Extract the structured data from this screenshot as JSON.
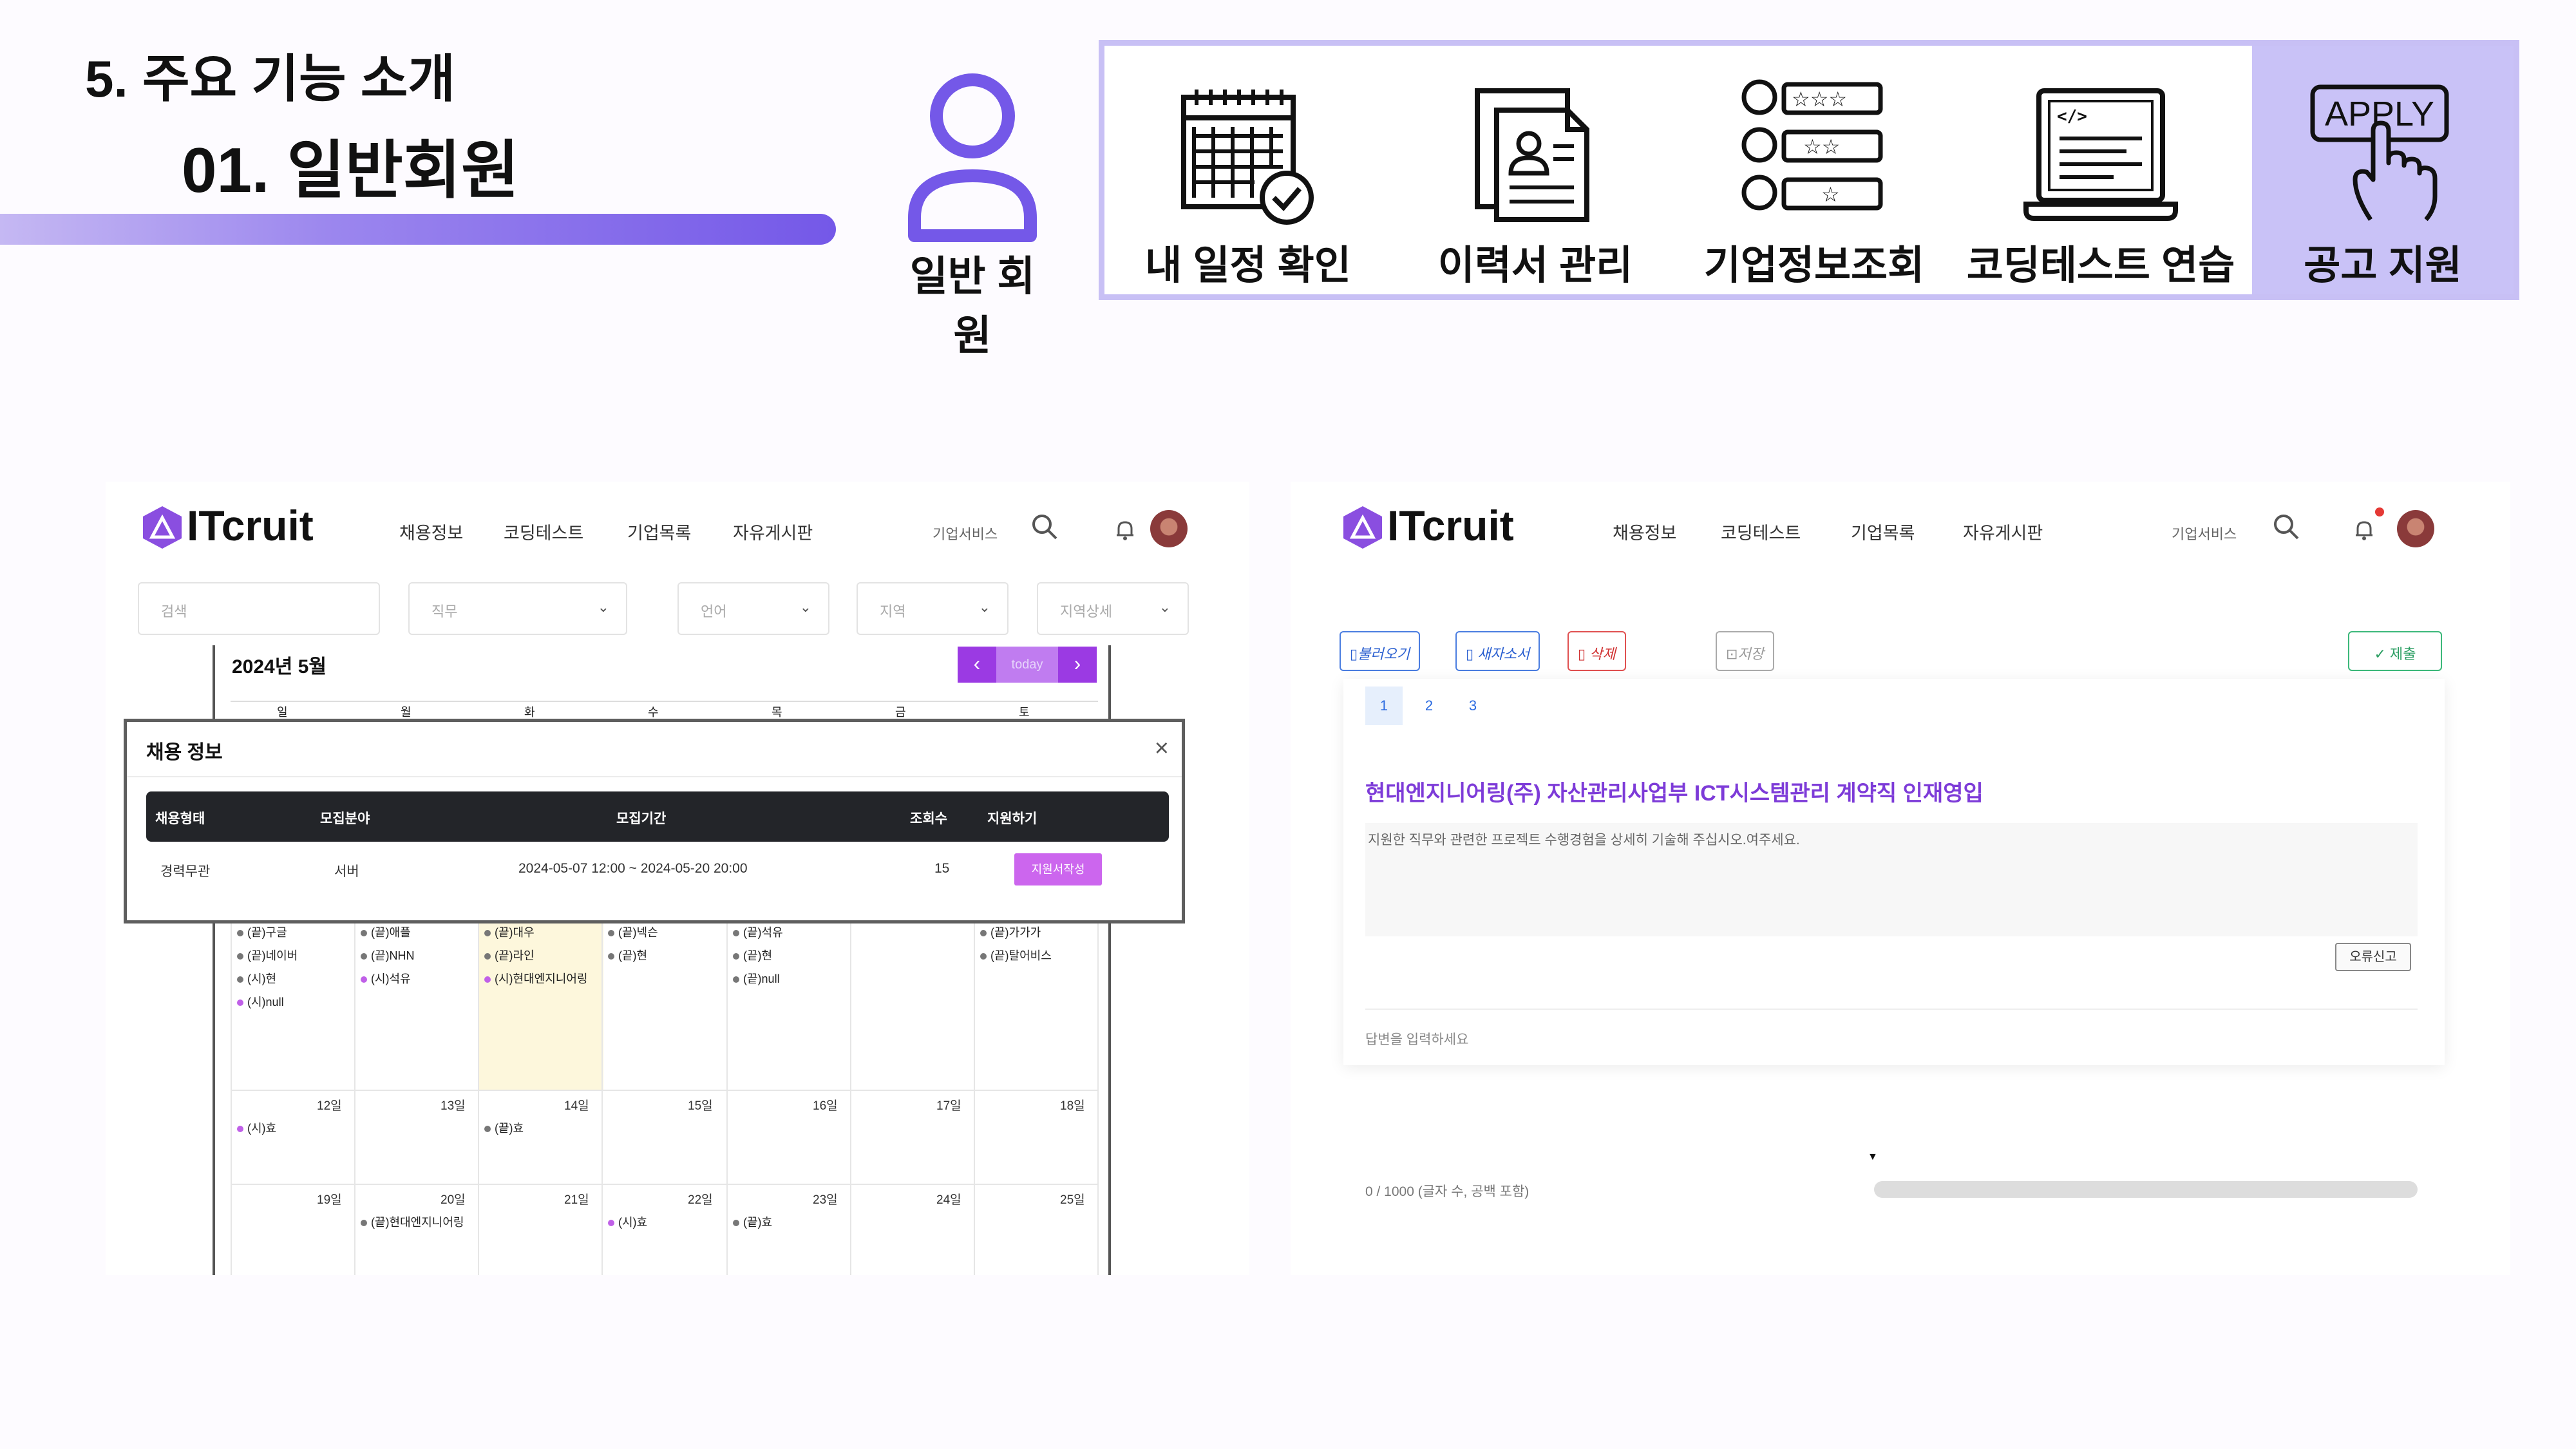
{
  "slide": {
    "section_title": "5. 주요 기능 소개",
    "subtitle": "01. 일반회원",
    "user_label": "일반 회원",
    "features": [
      {
        "label": "내 일정 확인",
        "icon": "calendar-check-icon"
      },
      {
        "label": "이력서 관리",
        "icon": "resume-document-icon"
      },
      {
        "label": "기업정보조회",
        "icon": "company-rating-icon"
      },
      {
        "label": "코딩테스트 연습",
        "icon": "laptop-code-icon"
      },
      {
        "label": "공고 지원",
        "icon": "apply-hand-icon",
        "icon_text": "APPLY"
      }
    ],
    "colors": {
      "accent": "#7458e8",
      "feature_border": "#c8c0f5",
      "active_feature": "#c9c2f7"
    }
  },
  "left_screen": {
    "logo": "ITcruit",
    "nav": [
      "채용정보",
      "코딩테스트",
      "기업목록",
      "자유게시판"
    ],
    "biz": "기업서비스",
    "filters": [
      "검색",
      "직무",
      "언어",
      "지역",
      "지역상세"
    ],
    "calendar": {
      "title": "2024년 5월",
      "today_btn": "today",
      "prev": "‹",
      "next": "›",
      "weekdays": [
        "일",
        "월",
        "화",
        "수",
        "목",
        "금",
        "토"
      ],
      "week2_events": [
        [
          "(끝)구글",
          "(끝)네이버",
          "(시)현",
          "(시)null"
        ],
        [
          "(끝)애플",
          "(끝)NHN",
          "(시)석유"
        ],
        [
          "(끝)대우",
          "(끝)라인",
          "(시)현대엔지니어링"
        ],
        [
          "(끝)넥슨",
          "(끝)현"
        ],
        [
          "(끝)석유",
          "(끝)현",
          "(끝)null"
        ],
        [],
        [
          "(끝)가가가",
          "(끝)탈어비스"
        ]
      ],
      "week3_days": [
        "12일",
        "13일",
        "14일",
        "15일",
        "16일",
        "17일",
        "18일"
      ],
      "week3_events": [
        [
          "(시)효"
        ],
        [],
        [
          "(끝)효"
        ],
        [],
        [],
        [],
        []
      ],
      "week4_days": [
        "19일",
        "20일",
        "21일",
        "22일",
        "23일",
        "24일",
        "25일"
      ],
      "week4_events": [
        [],
        [
          "(끝)현대엔지니어링"
        ],
        [],
        [
          "(시)효"
        ],
        [
          "(끝)효"
        ],
        [],
        []
      ]
    },
    "modal": {
      "title": "채용 정보",
      "close": "×",
      "headers": [
        "채용형태",
        "모집분야",
        "모집기간",
        "조회수",
        "지원하기"
      ],
      "row": {
        "type": "경력무관",
        "field": "서버",
        "period": "2024-05-07 12:00 ~ 2024-05-20 20:00",
        "views": "15",
        "apply": "지원서작성"
      }
    }
  },
  "right_screen": {
    "logo": "ITcruit",
    "nav": [
      "채용정보",
      "코딩테스트",
      "기업목록",
      "자유게시판"
    ],
    "biz": "기업서비스",
    "buttons": {
      "load": "불러오기",
      "new": "새자소서",
      "delete": "삭제",
      "save": "저장",
      "submit": "제출"
    },
    "tabs": [
      "1",
      "2",
      "3"
    ],
    "job_title": "현대엔지니어링(주) 자산관리사업부 ICT시스템관리 계약직 인재영입",
    "question": "지원한 직무와 관련한 프로젝트 수행경험을 상세히 기술해 주십시오.여주세요.",
    "report_btn": "오류신고",
    "answer_placeholder": "답변을 입력하세요",
    "counter": "0 / 1000 (글자 수, 공백 포함)"
  }
}
